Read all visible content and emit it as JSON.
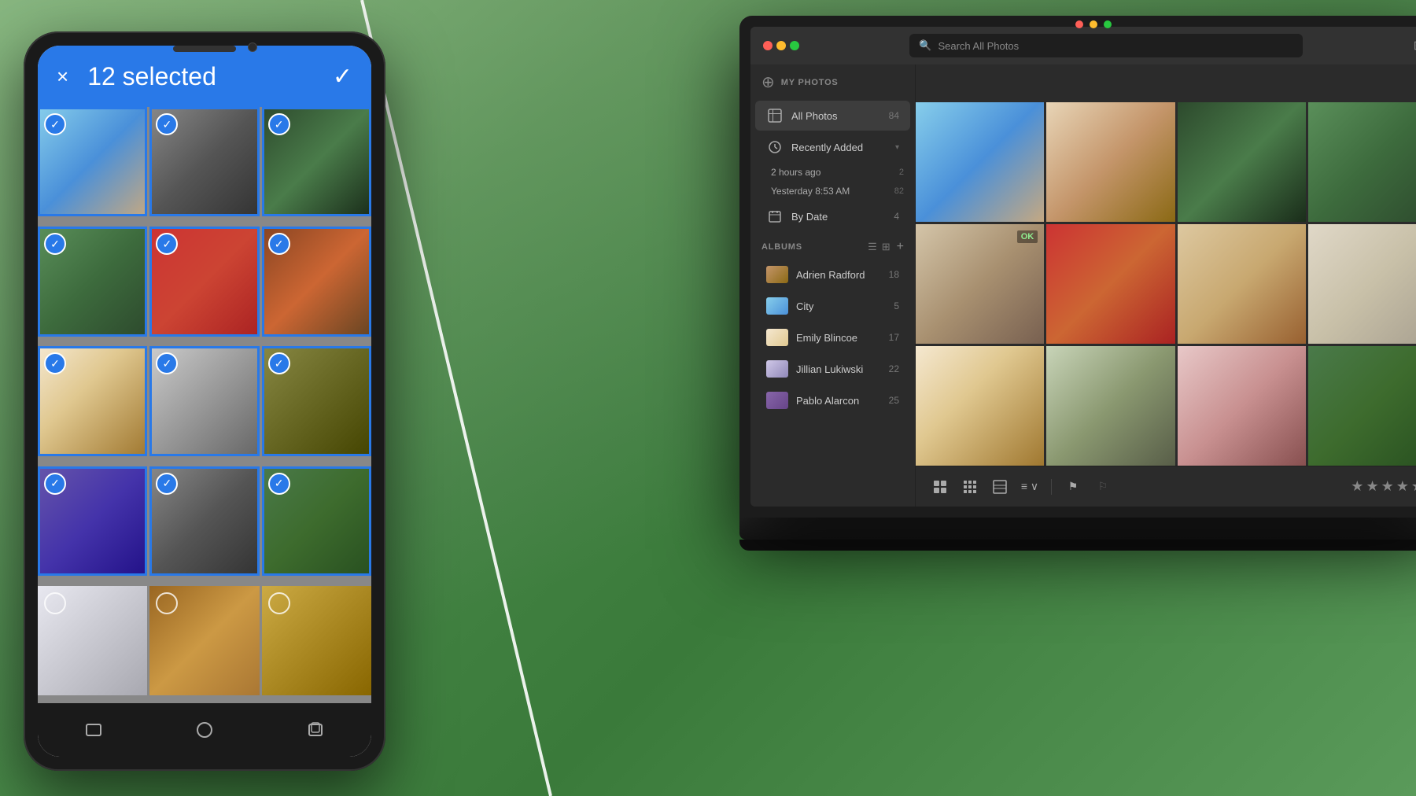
{
  "background": {
    "color": "#5a8a5a"
  },
  "phone": {
    "selected_count": "12 selected",
    "close_label": "×",
    "check_label": "✓",
    "photos": [
      {
        "id": 1,
        "selected": true,
        "color": "pp-1"
      },
      {
        "id": 2,
        "selected": true,
        "color": "pp-2"
      },
      {
        "id": 3,
        "selected": true,
        "color": "pp-3"
      },
      {
        "id": 4,
        "selected": true,
        "color": "pp-4"
      },
      {
        "id": 5,
        "selected": true,
        "color": "pp-5"
      },
      {
        "id": 6,
        "selected": true,
        "color": "pp-6"
      },
      {
        "id": 7,
        "selected": true,
        "color": "pp-7"
      },
      {
        "id": 8,
        "selected": true,
        "color": "pp-8"
      },
      {
        "id": 9,
        "selected": true,
        "color": "pp-9"
      },
      {
        "id": 10,
        "selected": true,
        "color": "pp-10"
      },
      {
        "id": 11,
        "selected": true,
        "color": "pp-11"
      },
      {
        "id": 12,
        "selected": true,
        "color": "pp-12"
      },
      {
        "id": 13,
        "selected": false,
        "color": "pp-13"
      },
      {
        "id": 14,
        "selected": false,
        "color": "pp-14"
      },
      {
        "id": 15,
        "selected": false,
        "color": "pp-15"
      }
    ],
    "nav_buttons": [
      "back-icon",
      "home-icon",
      "recents-icon"
    ]
  },
  "laptop": {
    "window_controls": {
      "red": "#ff5f57",
      "yellow": "#febc2e",
      "green": "#28c840"
    },
    "sidebar": {
      "my_photos_label": "MY PHOTOS",
      "add_button_label": "+",
      "all_photos": {
        "label": "All Photos",
        "count": "84"
      },
      "recently_added": {
        "label": "Recently Added",
        "items": [
          {
            "label": "2 hours ago",
            "count": "2"
          },
          {
            "label": "Yesterday 8:53 AM",
            "count": "82"
          }
        ]
      },
      "by_date": {
        "label": "By Date",
        "count": "4"
      },
      "albums_label": "ALBUMS",
      "albums": [
        {
          "name": "Adrien Radford",
          "count": "18",
          "color": "thumb-adrien"
        },
        {
          "name": "City",
          "count": "5",
          "color": "thumb-city"
        },
        {
          "name": "Emily Blincoe",
          "count": "17",
          "color": "thumb-emily"
        },
        {
          "name": "Jillian Lukiwski",
          "count": "22",
          "color": "thumb-jillian"
        },
        {
          "name": "Pablo Alarcon",
          "count": "25",
          "color": "thumb-pablo"
        }
      ]
    },
    "search": {
      "placeholder": "Search All Photos"
    },
    "photos": [
      {
        "id": 1,
        "color": "pc-1"
      },
      {
        "id": 2,
        "color": "pc-2"
      },
      {
        "id": 3,
        "color": "pc-3"
      },
      {
        "id": 4,
        "color": "pc-4"
      },
      {
        "id": 5,
        "color": "pc-5"
      },
      {
        "id": 6,
        "color": "pc-6"
      },
      {
        "id": 7,
        "color": "pc-7"
      },
      {
        "id": 8,
        "color": "pc-8"
      },
      {
        "id": 9,
        "color": "pc-9"
      },
      {
        "id": 10,
        "color": "pc-10"
      },
      {
        "id": 11,
        "color": "pc-11"
      },
      {
        "id": 12,
        "color": "pc-12"
      }
    ],
    "toolbar": {
      "view_icons": [
        "grid-large-icon",
        "grid-medium-icon",
        "grid-small-icon",
        "list-icon"
      ],
      "sort_label": "≡ ∨",
      "flag_icons": [
        "flag-icon",
        "flag-outline-icon"
      ],
      "stars": [
        "★",
        "★",
        "★",
        "★",
        "★"
      ]
    }
  }
}
